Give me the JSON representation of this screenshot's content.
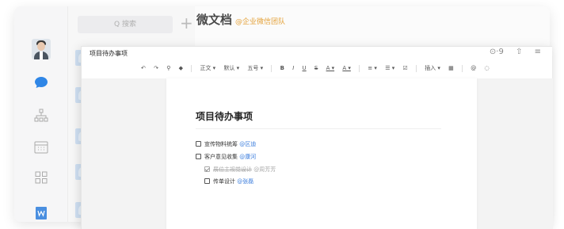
{
  "search": {
    "placeholder": "Q 搜索",
    "plus": "+"
  },
  "app": {
    "title": "微文档",
    "subtitle": "@企业微信团队"
  },
  "editor": {
    "doc_tab_title": "项目待办事项",
    "top_icons": {
      "collab": "⊙·9",
      "share": "⇧",
      "menu": "≡"
    },
    "toolbar": {
      "undo": "↶",
      "redo": "↷",
      "format_painter": "⚲",
      "clear": "◆",
      "style": "正文 ▾",
      "font": "默认 ▾",
      "size": "五号 ▾",
      "bold": "B",
      "italic": "I",
      "underline": "U",
      "strike": "S",
      "font_color": "A ▾",
      "highlight": "A ▾",
      "align": "≡ ▾",
      "list": "☰ ▾",
      "todo": "☑",
      "insert": "插入 ▾",
      "table": "▦",
      "mention": "@",
      "comment": "◌"
    }
  },
  "document": {
    "heading": "项目待办事项",
    "todos": [
      {
        "text": "宣传物料统筹",
        "mention": "@区迪",
        "done": false
      },
      {
        "text": "客户意见收集",
        "mention": "@康河",
        "done": false
      },
      {
        "text": "展位主视觉设计",
        "mention": "@周芳芳",
        "done": true
      },
      {
        "text": "传单设计",
        "mention": "@张磊",
        "done": false
      }
    ]
  },
  "colors": {
    "accent": "#3b7ddd",
    "brand_orange": "#e4a23a",
    "chat_blue": "#2f86e6"
  }
}
